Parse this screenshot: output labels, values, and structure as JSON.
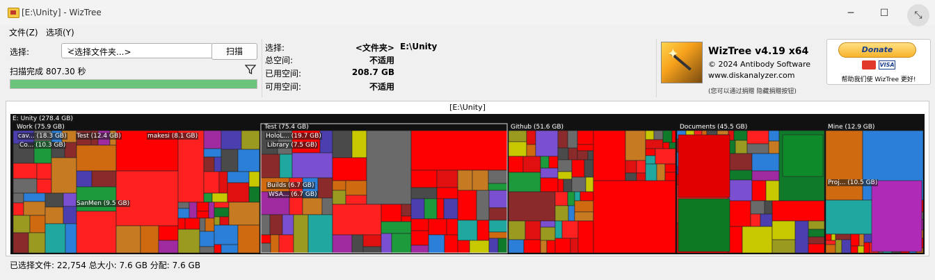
{
  "window": {
    "title": "[E:\\Unity]  - WizTree",
    "minimize_icon": "─",
    "maximize_icon": "☐",
    "close_icon": "⤡"
  },
  "menu": [
    {
      "label": "文件(Z)"
    },
    {
      "label": "选项(Y)"
    }
  ],
  "scan_panel": {
    "select_label": "选择:",
    "folder_select_value": "<选择文件夹...>",
    "scan_button": "扫描",
    "status": "扫描完成 807.30 秒",
    "progress": 1.0
  },
  "info_panel": {
    "selected_label": "选择:",
    "selected_type": "<文件夹>",
    "selected_path": "E:\\Unity",
    "total_label": "总空间:",
    "total_value": "不适用",
    "used_label": "已用空间:",
    "used_value": "208.7 GB",
    "free_label": "可用空间:",
    "free_value": "不适用"
  },
  "brand": {
    "name": "WizTree v4.19 x64",
    "copyright": "© 2024 Antibody Software",
    "site": "www.diskanalyzer.com",
    "note": "(您可以通过捐赠 隐藏捐赠按钮)"
  },
  "donate": {
    "button": "Donate",
    "visa": "VISA",
    "note": "帮助我们使 WizTree 更好!"
  },
  "treemap": {
    "title": "[E:\\Unity]",
    "labels": [
      "E: Unity  (278.4 GB)",
      "Work  (75.9 GB)",
      "cav...  (18.3 GB)",
      "Co...  (10.3 GB)",
      "Test  (12.4 GB)",
      "makesi  (8.1 GB)",
      "SanMen  (9.5 GB)",
      "Test  (75.4 GB)",
      "HoloL...  (19.7 GB)",
      "Library  (7.5 GB)",
      "Builds  (6.7 GB)",
      "WSA...  (6.7 GB)",
      "Github  (51.6 GB)",
      "Documents  (45.5 GB)",
      "Mine  (12.9 GB)",
      "Proj...  (10.5 GB)"
    ]
  },
  "status_bar": "已选择文件: 22,754  总大小: 7.6 GB  分配: 7.6 GB"
}
